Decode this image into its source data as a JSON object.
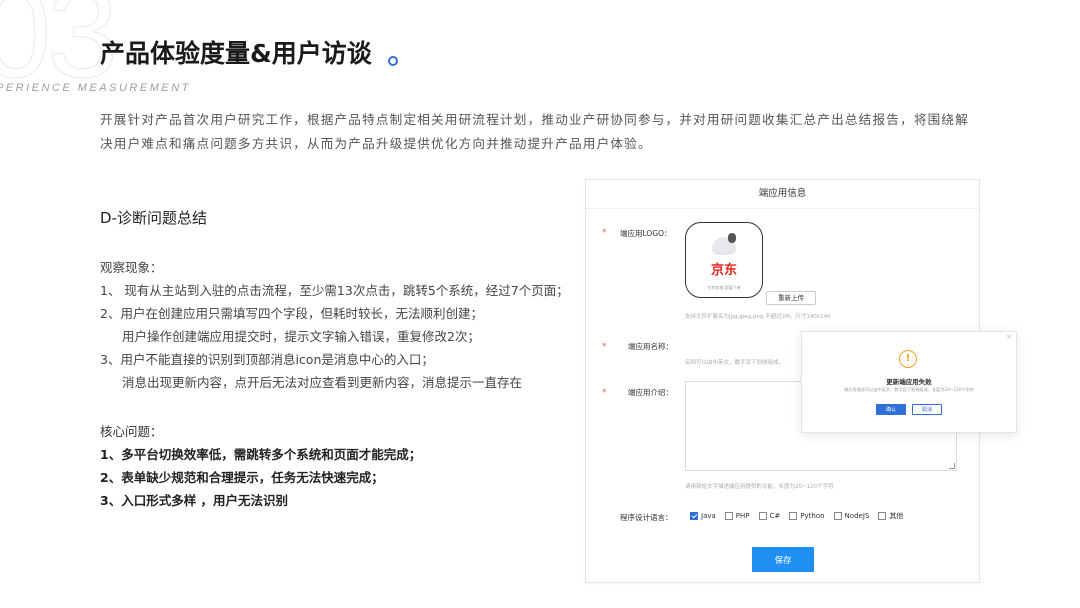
{
  "slide": {
    "number": "03",
    "title": "产品体验度量&用户访谈",
    "subtitle_en": "PERIENCE MEASUREMENT",
    "intro": "开展针对产品首次用户研究工作，根据产品特点制定相关用研流程计划，推动业产研协同参与，并对用研问题收集汇总产出总结报告，将围绕解决用户难点和痛点问题多方共识，从而为产品升级提供优化方向并推动提升产品用户体验。"
  },
  "diagnosis": {
    "section_title": "D-诊断问题总结",
    "observation_head": "观察现象：",
    "observations": [
      "1、 现有从主站到入驻的点击流程，至少需13次点击，跳转5个系统，经过7个页面；",
      "2、用户在创建应用只需填写四个字段，但耗时较长，无法顺利创建；",
      "用户操作创建端应用提交时，提示文字输入错误，重复修改2次；",
      "3、用户不能直接的识别到顶部消息icon是消息中心的入口；",
      "消息出现更新内容，点开后无法对应查看到更新内容，消息提示一直存在"
    ],
    "core_head": "核心问题：",
    "core_items": [
      "1、多平台切换效率低，需跳转多个系统和页面才能完成；",
      "2、表单缺少规范和合理提示，任务无法快速完成；",
      "3、入口形式多样 ，用户无法识别"
    ]
  },
  "form": {
    "header": "端应用信息",
    "logo_label": "端应用LOGO：",
    "logo_text": "京东",
    "logo_tiny": "京东商城  超值下单",
    "reupload_label": "重新上传",
    "logo_hint": "支持文件扩展名为jpg,jpeg,png,不超过2M，尺寸140x140",
    "name_label": "端应用名称：",
    "name_hint": "名称可以由中英文，数字及下划线组成，",
    "intro_label": "端应用介绍：",
    "intro_hint": "请用简短文字描述端应用提供的功能，长度为20~120个字符",
    "lang_label": "程序设计语言：",
    "languages": [
      {
        "label": "Java",
        "checked": true
      },
      {
        "label": "PHP",
        "checked": false
      },
      {
        "label": "C#",
        "checked": false
      },
      {
        "label": "Python",
        "checked": false
      },
      {
        "label": "NodeJS",
        "checked": false
      },
      {
        "label": "其他",
        "checked": false
      }
    ],
    "save_label": "保存"
  },
  "modal": {
    "close": "×",
    "icon": "!",
    "title": "更新端应用失败",
    "desc": "端应用描述可以由中英文，数字及下划线组成，长度为20~120个字符",
    "ok_label": "确认",
    "cancel_label": "取消"
  },
  "colors": {
    "accent": "#2f6fd6",
    "primary_button": "#1f8ff2",
    "warning": "#f0a020",
    "required_star": "#e55555",
    "jd_red": "#e1251b"
  }
}
